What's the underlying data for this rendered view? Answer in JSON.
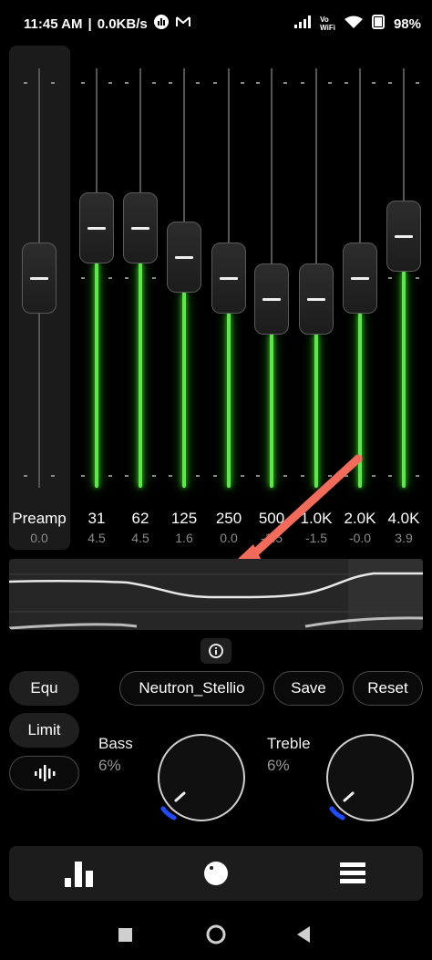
{
  "status_bar": {
    "time": "11:45 AM",
    "speed": "0.0KB/s",
    "battery": "98",
    "battery_suffix": "%",
    "vo_label": "Vo",
    "wifi_label": "WiFi"
  },
  "equalizer": {
    "preamp": {
      "label": "Preamp",
      "value": "0.0",
      "level": 0.5
    },
    "bands": [
      {
        "label": "31",
        "value": "4.5",
        "level": 0.62
      },
      {
        "label": "62",
        "value": "4.5",
        "level": 0.62
      },
      {
        "label": "125",
        "value": "1.6",
        "level": 0.55
      },
      {
        "label": "250",
        "value": "0.0",
        "level": 0.5
      },
      {
        "label": "500",
        "value": "-1.5",
        "level": 0.45
      },
      {
        "label": "1.0K",
        "value": "-1.5",
        "level": 0.45
      },
      {
        "label": "2.0K",
        "value": "-0.0",
        "level": 0.5
      },
      {
        "label": "4.0K",
        "value": "3.9",
        "level": 0.6
      }
    ]
  },
  "controls": {
    "equ_label": "Equ",
    "limit_label": "Limit",
    "preset_label": "Neutron_Stellio",
    "save_label": "Save",
    "reset_label": "Reset"
  },
  "knobs": {
    "bass": {
      "label": "Bass",
      "percent": "6%"
    },
    "treble": {
      "label": "Treble",
      "percent": "6%"
    }
  },
  "colors": {
    "accent_green": "#5ee64a",
    "arrow_red": "#f26b5b",
    "knob_blue": "#1e4bff"
  },
  "bottom_nav": [
    "equalizer-icon",
    "dial-icon",
    "menu-icon"
  ]
}
